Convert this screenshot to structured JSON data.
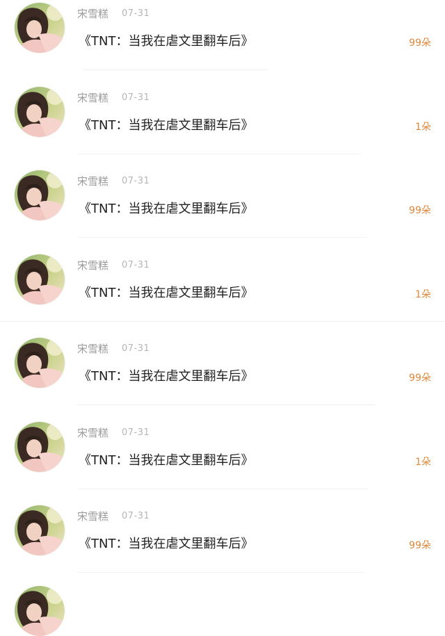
{
  "feed": {
    "items": [
      {
        "user": "宋雪糕",
        "date": "07-31",
        "title": "《TNT：当我在虐文里翻车后》",
        "count": "99朵"
      },
      {
        "user": "宋雪糕",
        "date": "07-31",
        "title": "《TNT：当我在虐文里翻车后》",
        "count": "1朵"
      },
      {
        "user": "宋雪糕",
        "date": "07-31",
        "title": "《TNT：当我在虐文里翻车后》",
        "count": "99朵"
      },
      {
        "user": "宋雪糕",
        "date": "07-31",
        "title": "《TNT：当我在虐文里翻车后》",
        "count": "1朵"
      },
      {
        "user": "宋雪糕",
        "date": "07-31",
        "title": "《TNT：当我在虐文里翻车后》",
        "count": "99朵"
      },
      {
        "user": "宋雪糕",
        "date": "07-31",
        "title": "《TNT：当我在虐文里翻车后》",
        "count": "1朵"
      },
      {
        "user": "宋雪糕",
        "date": "07-31",
        "title": "《TNT：当我在虐文里翻车后》",
        "count": "99朵"
      }
    ]
  },
  "colors": {
    "count_accent": "#e0883a",
    "username_gray": "#9a9a9a",
    "title_text": "#1f1f1f"
  },
  "icons": {
    "avatar": "user-avatar-photo"
  }
}
